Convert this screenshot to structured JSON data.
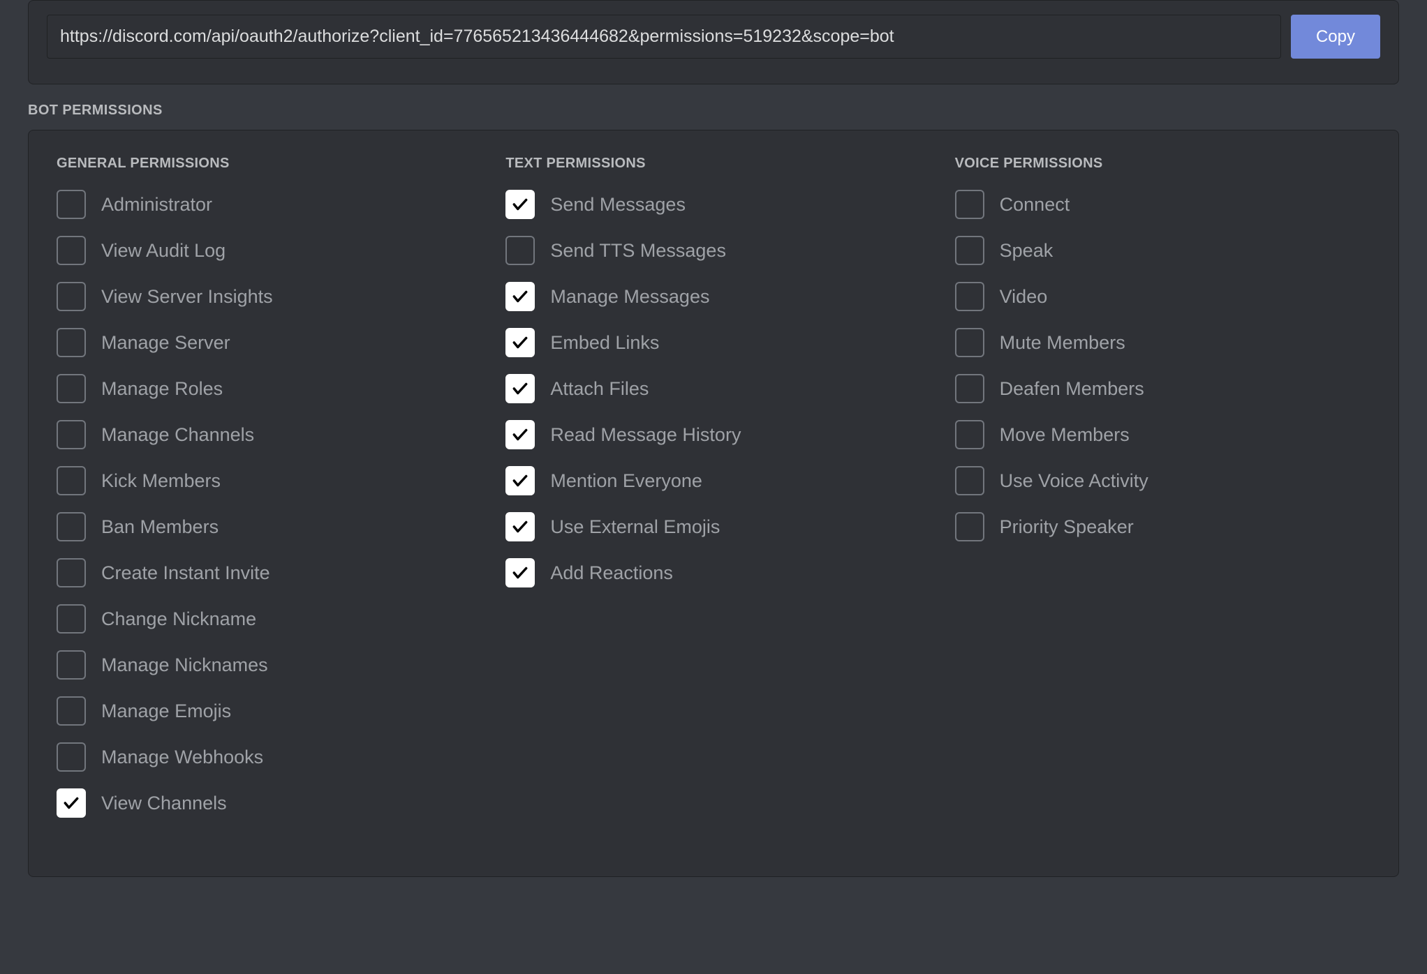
{
  "url_box": {
    "url": "https://discord.com/api/oauth2/authorize?client_id=776565213436444682&permissions=519232&scope=bot",
    "copy_label": "Copy"
  },
  "section_title": "BOT PERMISSIONS",
  "columns": [
    {
      "heading": "GENERAL PERMISSIONS",
      "items": [
        {
          "label": "Administrator",
          "checked": false
        },
        {
          "label": "View Audit Log",
          "checked": false
        },
        {
          "label": "View Server Insights",
          "checked": false
        },
        {
          "label": "Manage Server",
          "checked": false
        },
        {
          "label": "Manage Roles",
          "checked": false
        },
        {
          "label": "Manage Channels",
          "checked": false
        },
        {
          "label": "Kick Members",
          "checked": false
        },
        {
          "label": "Ban Members",
          "checked": false
        },
        {
          "label": "Create Instant Invite",
          "checked": false
        },
        {
          "label": "Change Nickname",
          "checked": false
        },
        {
          "label": "Manage Nicknames",
          "checked": false
        },
        {
          "label": "Manage Emojis",
          "checked": false
        },
        {
          "label": "Manage Webhooks",
          "checked": false
        },
        {
          "label": "View Channels",
          "checked": true
        }
      ]
    },
    {
      "heading": "TEXT PERMISSIONS",
      "items": [
        {
          "label": "Send Messages",
          "checked": true
        },
        {
          "label": "Send TTS Messages",
          "checked": false
        },
        {
          "label": "Manage Messages",
          "checked": true
        },
        {
          "label": "Embed Links",
          "checked": true
        },
        {
          "label": "Attach Files",
          "checked": true
        },
        {
          "label": "Read Message History",
          "checked": true
        },
        {
          "label": "Mention Everyone",
          "checked": true
        },
        {
          "label": "Use External Emojis",
          "checked": true
        },
        {
          "label": "Add Reactions",
          "checked": true
        }
      ]
    },
    {
      "heading": "VOICE PERMISSIONS",
      "items": [
        {
          "label": "Connect",
          "checked": false
        },
        {
          "label": "Speak",
          "checked": false
        },
        {
          "label": "Video",
          "checked": false
        },
        {
          "label": "Mute Members",
          "checked": false
        },
        {
          "label": "Deafen Members",
          "checked": false
        },
        {
          "label": "Move Members",
          "checked": false
        },
        {
          "label": "Use Voice Activity",
          "checked": false
        },
        {
          "label": "Priority Speaker",
          "checked": false
        }
      ]
    }
  ]
}
